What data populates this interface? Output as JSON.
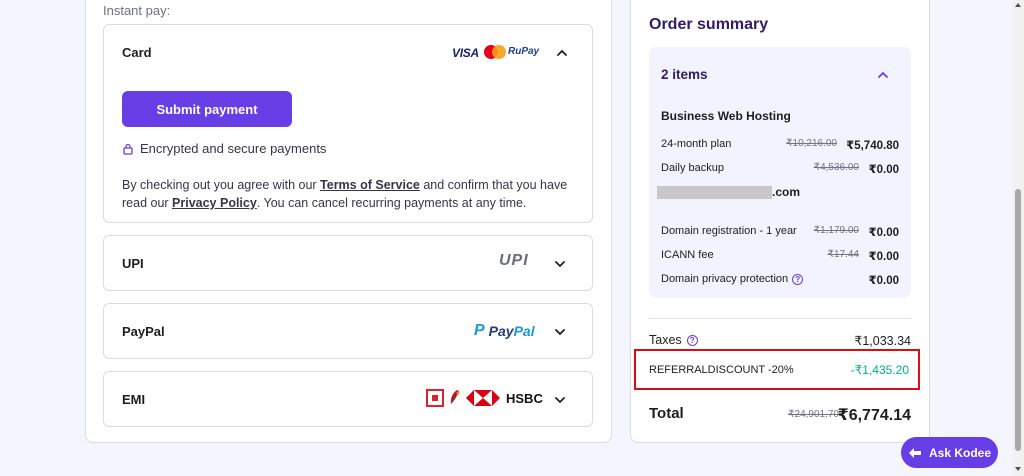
{
  "payment": {
    "instant_pay_label": "Instant pay:",
    "card": {
      "title": "Card",
      "brands": {
        "visa": "VISA",
        "rupay": "RuPay"
      },
      "submit_label": "Submit payment",
      "secure_text": "Encrypted and secure payments",
      "terms_prefix": "By checking out you agree with our ",
      "terms_link": "Terms of Service",
      "terms_middle": " and confirm that you have read our ",
      "privacy_link": "Privacy Policy",
      "terms_suffix": ". You can cancel recurring payments at any time."
    },
    "upi": {
      "title": "UPI",
      "logo_text": "UPI"
    },
    "paypal": {
      "title": "PayPal",
      "logo_pay": "Pay",
      "logo_pal": "Pal"
    },
    "emi": {
      "title": "EMI",
      "hsbc_text": "HSBC"
    }
  },
  "order": {
    "title": "Order summary",
    "items_count": "2 items",
    "product_name": "Business Web Hosting",
    "rows": [
      {
        "label": "24-month plan",
        "old": "₹10,216.00",
        "new": "₹5,740.80"
      },
      {
        "label": "Daily backup",
        "old": "₹4,536.00",
        "new": "₹0.00"
      }
    ],
    "domain_tld": ".com",
    "domain_rows": [
      {
        "label": "Domain registration - 1 year",
        "old": "₹1,179.00",
        "new": "₹0.00"
      },
      {
        "label": "ICANN fee",
        "old": "₹17.44",
        "new": "₹0.00"
      },
      {
        "label": "Domain privacy protection",
        "old": "",
        "new": "₹0.00"
      }
    ],
    "taxes_label": "Taxes",
    "taxes_value": "₹1,033.34",
    "referral_label": "REFERRALDISCOUNT -20%",
    "referral_value": "-₹1,435.20",
    "total_label": "Total",
    "total_old": "₹24,901.70",
    "total_new": "₹6,774.14"
  },
  "assistant": {
    "label": "Ask Kodee"
  },
  "icons": {
    "chevron_up": "chevron-up-icon",
    "chevron_down": "chevron-down-icon",
    "lock": "lock-icon",
    "help": "help-icon",
    "kodee": "kodee-icon"
  },
  "colors": {
    "accent": "#673de6",
    "discount": "#00b090",
    "highlight_border": "#e00b12"
  }
}
